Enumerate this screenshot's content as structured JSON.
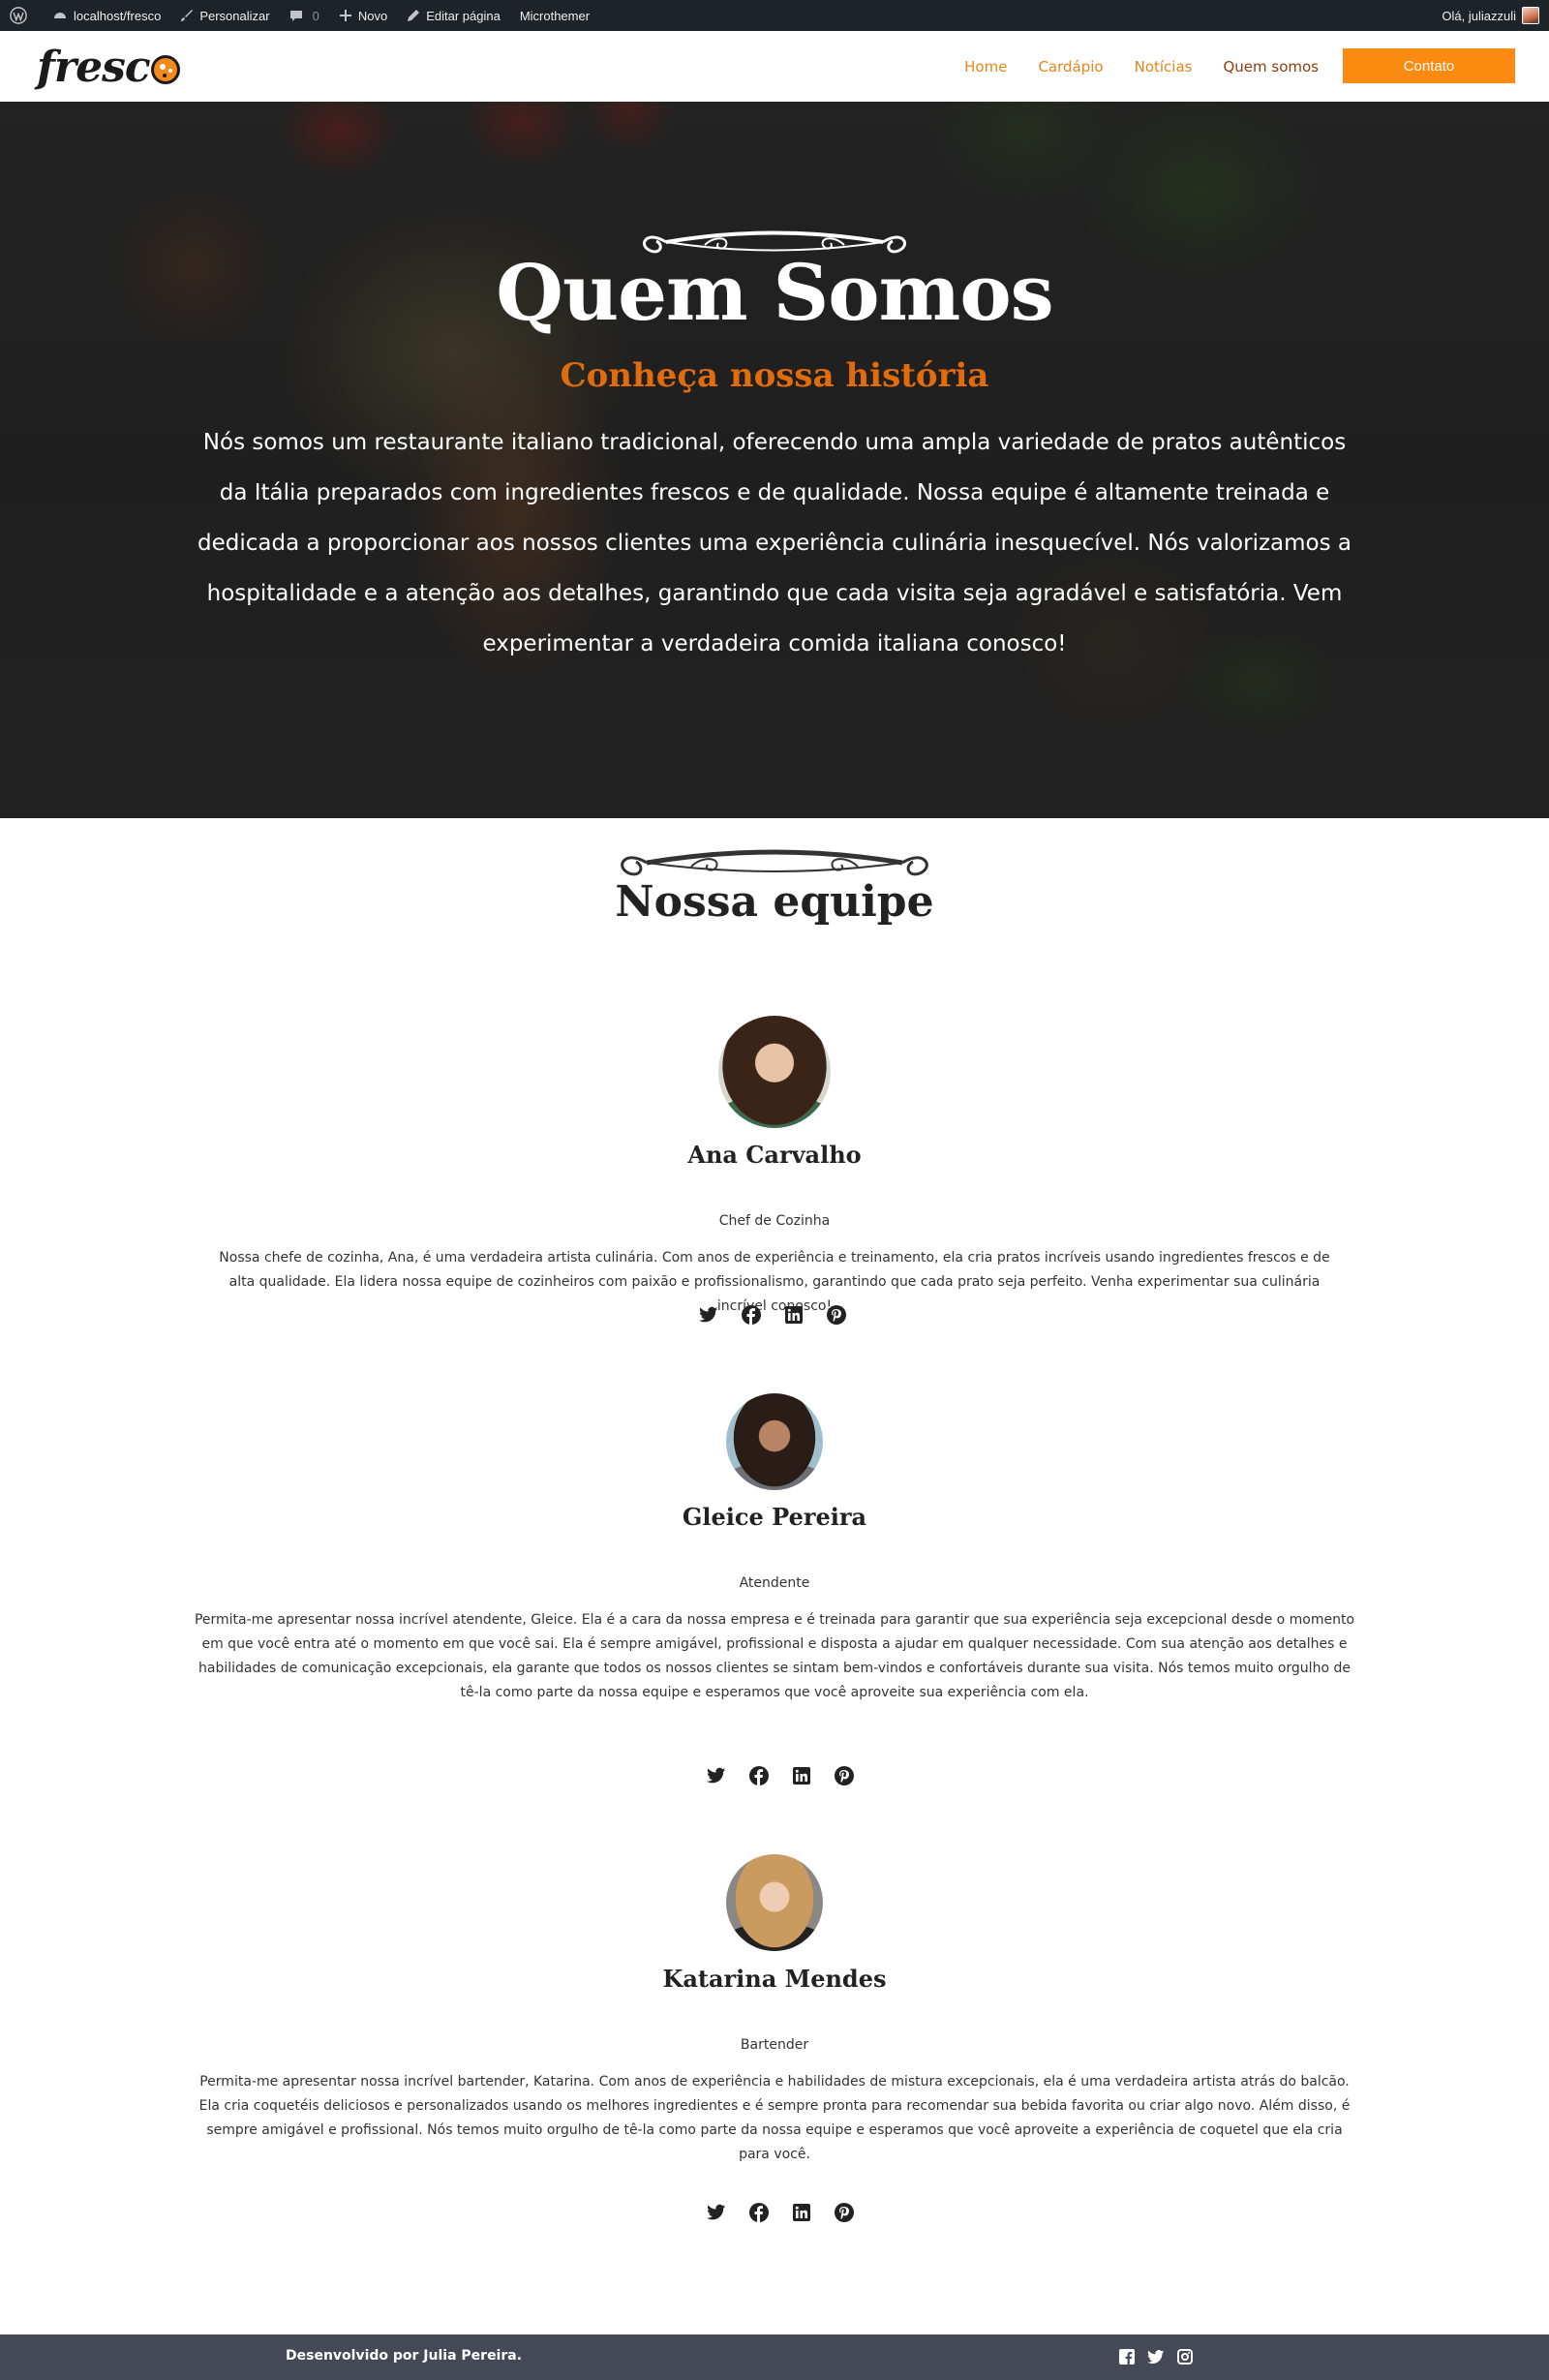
{
  "adminbar": {
    "site": "localhost/fresco",
    "customize": "Personalizar",
    "comments_count": "0",
    "new": "Novo",
    "edit_page": "Editar página",
    "microthemer": "Microthemer",
    "greeting": "Olá, juliazzuli"
  },
  "header": {
    "logo_text": "fresc",
    "nav": [
      "Home",
      "Cardápio",
      "Notícias",
      "Quem somos"
    ],
    "active_nav": "Quem somos",
    "contact_label": "Contato",
    "accent_color": "#fb8b10"
  },
  "hero": {
    "title": "Quem Somos",
    "subtitle": "Conheça nossa história",
    "text": "Nós somos um restaurante italiano tradicional, oferecendo uma ampla variedade de pratos autênticos da Itália preparados com ingredientes frescos e de qualidade. Nossa equipe é altamente treinada e dedicada a proporcionar aos nossos clientes uma experiência culinária inesquecível. Nós valorizamos a hospitalidade e a atenção aos detalhes, garantindo que cada visita seja agradável e satisfatória. Vem experimentar a verdadeira comida italiana conosco!"
  },
  "team": {
    "title": "Nossa equipe",
    "members": [
      {
        "name": "Ana Carvalho",
        "role": "Chef de Cozinha",
        "bio": "Nossa chefe de cozinha, Ana, é uma verdadeira artista culinária. Com anos de experiência e treinamento, ela cria pratos incríveis usando ingredientes frescos e de alta qualidade. Ela lidera nossa equipe de cozinheiros com paixão e profissionalismo, garantindo que cada prato seja perfeito. Venha experimentar sua culinária incrível conosco!"
      },
      {
        "name": "Gleice Pereira",
        "role": "Atendente",
        "bio": "Permita-me apresentar nossa incrível atendente, Gleice. Ela é a cara da nossa empresa e é treinada para garantir que sua experiência seja excepcional desde o momento em que você entra até o momento em que você sai. Ela é sempre amigável, profissional e disposta a ajudar em qualquer necessidade. Com sua atenção aos detalhes e habilidades de comunicação excepcionais, ela garante que todos os nossos clientes se sintam bem-vindos e confortáveis durante sua visita. Nós temos muito orgulho de tê-la como parte da nossa equipe e esperamos que você aproveite sua experiência com ela."
      },
      {
        "name": "Katarina Mendes",
        "role": "Bartender",
        "bio": "Permita-me apresentar nossa incrível bartender, Katarina. Com anos de experiência e habilidades de mistura excepcionais, ela é uma verdadeira artista atrás do balcão. Ela cria coquetéis deliciosos e personalizados usando os melhores ingredientes e é sempre pronta para recomendar sua bebida favorita ou criar algo novo. Além disso, é sempre amigável e profissional. Nós temos muito orgulho de tê-la como parte da nossa equipe e esperamos que você aproveite a experiência de coquetel que ela cria para você."
      }
    ],
    "social_icons": [
      "twitter-icon",
      "facebook-icon",
      "linkedin-icon",
      "pinterest-icon"
    ]
  },
  "footer": {
    "text": "Desenvolvido por Julia Pereira.",
    "icons": [
      "facebook-square-icon",
      "twitter-icon",
      "instagram-icon"
    ],
    "background": "#454955"
  }
}
